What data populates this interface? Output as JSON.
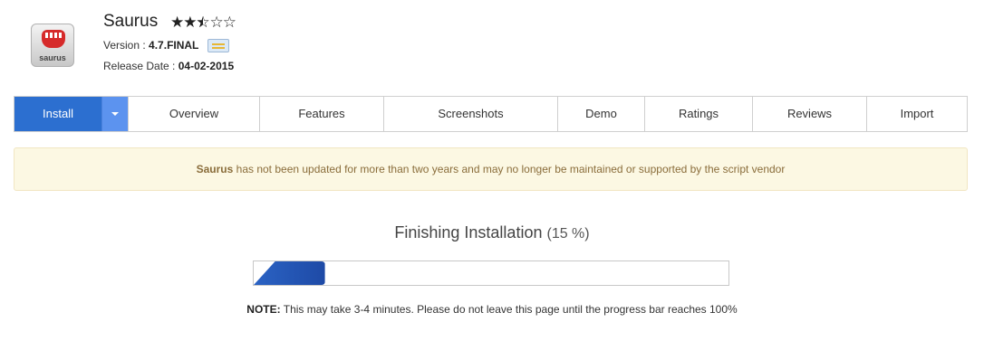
{
  "app": {
    "name": "Saurus",
    "logo_text": "saurus",
    "rating": 2.5,
    "rating_max": 5,
    "version_label": "Version :",
    "version": "4.7.FINAL",
    "release_label": "Release Date :",
    "release_date": "04-02-2015"
  },
  "tabs": {
    "install": "Install",
    "overview": "Overview",
    "features": "Features",
    "screenshots": "Screenshots",
    "demo": "Demo",
    "ratings": "Ratings",
    "reviews": "Reviews",
    "import": "Import"
  },
  "warning": {
    "app_name": "Saurus",
    "text": " has not been updated for more than two years and may no longer be maintained or supported by the script vendor"
  },
  "progress": {
    "title": "Finishing Installation",
    "percent_text": "(15 %)",
    "percent": 15,
    "note_label": "NOTE:",
    "note_text": " This may take 3-4 minutes. Please do not leave this page until the progress bar reaches 100%"
  },
  "colors": {
    "accent": "#2c6fd0",
    "accent_light": "#5c93ef",
    "warning_bg": "#fcf8e3",
    "warning_text": "#8a6d3b",
    "progress_fill": "#1e4aa6"
  },
  "icons": {
    "logo": "saurus-logo-icon",
    "rating": "star-icon",
    "version_note": "note-icon",
    "dropdown": "chevron-down-icon"
  }
}
